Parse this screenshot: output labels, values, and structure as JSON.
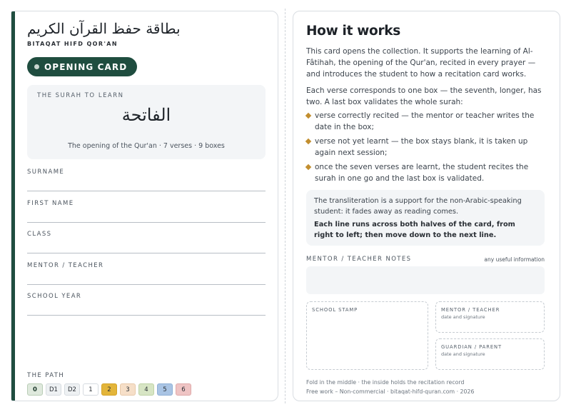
{
  "left": {
    "arabic_title": "بطاقة حفظ القرآن الكريم",
    "latin_title": "BITAQAT HIFD QOR'AN",
    "badge": "OPENING CARD",
    "surah": {
      "label": "THE SURAH TO LEARN",
      "arabic": "الفاتحة",
      "subtitle": "The opening of the Qur'an · 7 verses · 9 boxes"
    },
    "fields": [
      {
        "label": "SURNAME"
      },
      {
        "label": "FIRST NAME"
      },
      {
        "label": "CLASS"
      },
      {
        "label": "MENTOR / TEACHER"
      },
      {
        "label": "SCHOOL YEAR"
      }
    ],
    "path": {
      "label": "THE PATH",
      "steps": [
        {
          "label": "0",
          "bg": "#dfe9dd",
          "border": "#b9cdb6",
          "color": "#1f3b2e"
        },
        {
          "label": "D1",
          "bg": "#eef1f3",
          "border": "#d6dbe0",
          "color": "#2a2f35"
        },
        {
          "label": "D2",
          "bg": "#eef1f3",
          "border": "#d6dbe0",
          "color": "#2a2f35"
        },
        {
          "label": "1",
          "bg": "#ffffff",
          "border": "#d6dbe0",
          "color": "#2a2f35"
        },
        {
          "label": "2",
          "bg": "#e3b53a",
          "border": "#d4a327",
          "color": "#2a2f35"
        },
        {
          "label": "3",
          "bg": "#f6dfc8",
          "border": "#e8c9aa",
          "color": "#2a2f35"
        },
        {
          "label": "4",
          "bg": "#d7e5c4",
          "border": "#bfd3a6",
          "color": "#2a2f35"
        },
        {
          "label": "5",
          "bg": "#a9c4e4",
          "border": "#8fb0d6",
          "color": "#2a2f35"
        },
        {
          "label": "6",
          "bg": "#efc4c4",
          "border": "#dfa9a9",
          "color": "#2a2f35"
        }
      ]
    }
  },
  "right": {
    "title": "How it works",
    "intro": "This card opens the collection. It supports the learning of Al-Fâtihah, the opening of the Qur'an, recited in every prayer — and introduces the student to how a recitation card works.",
    "verses": "Each verse corresponds to one box — the seventh, longer, has two. A last box validates the whole surah:",
    "bullets": [
      "verse correctly recited — the mentor or teacher writes the date in the box;",
      "verse not yet learnt — the box stays blank, it is taken up again next session;",
      "once the seven verses are learnt, the student recites the surah in one go and the last box is validated."
    ],
    "note": "The transliteration is a support for the non-Arabic-speaking student: it fades away as reading comes.",
    "note_bold": "Each line runs across both halves of the card, from right to left; then move down to the next line.",
    "notes_label": "MENTOR / TEACHER NOTES",
    "notes_hint": "any useful information",
    "stamp_label": "SCHOOL STAMP",
    "mentor_label": "MENTOR / TEACHER",
    "mentor_sub": "date and signature",
    "guardian_label": "GUARDIAN / PARENT",
    "guardian_sub": "date and signature",
    "footer1": "Fold in the middle · the inside holds the recitation record",
    "footer2": "Free work – Non-commercial · bitaqat-hifd-quran.com · 2026"
  },
  "colors": {
    "accent": "#1f4d3f",
    "bullet": "#c28e2f"
  }
}
